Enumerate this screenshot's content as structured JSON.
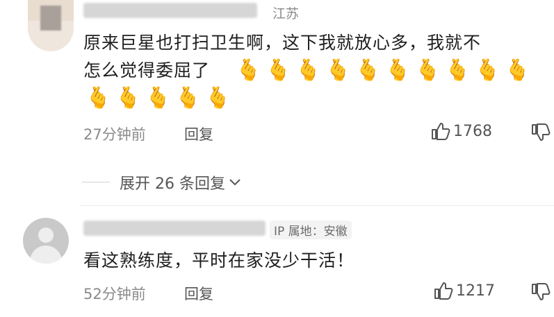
{
  "comments": [
    {
      "location": "江苏",
      "text_line1": "原来巨星也打扫卫生啊，这下我就放心多，我就不",
      "text_line2": "怎么觉得委屈了",
      "emoji_row1": [
        "🫰",
        "🫰",
        "🫰",
        "🫰",
        "🫰",
        "🫰",
        "🫰",
        "🫰",
        "🫰",
        "🫰"
      ],
      "emoji_row2": [
        "🫰",
        "🫰",
        "🫰",
        "🫰",
        "🫰"
      ],
      "time": "27分钟前",
      "reply_label": "回复",
      "likes": "1768",
      "expand_label": "展开 26 条回复"
    },
    {
      "ip_label": "IP 属地：安徽",
      "text": "看这熟练度，平时在家没少干活！",
      "time": "52分钟前",
      "reply_label": "回复",
      "likes": "1217"
    }
  ],
  "colors": {
    "text": "#1e1e1e",
    "meta": "#8a8a8a",
    "avatar_placeholder": "#c9c9c9"
  },
  "icons": [
    "thumbs-up-icon",
    "thumbs-down-icon",
    "chevron-down-icon",
    "default-avatar-icon"
  ]
}
